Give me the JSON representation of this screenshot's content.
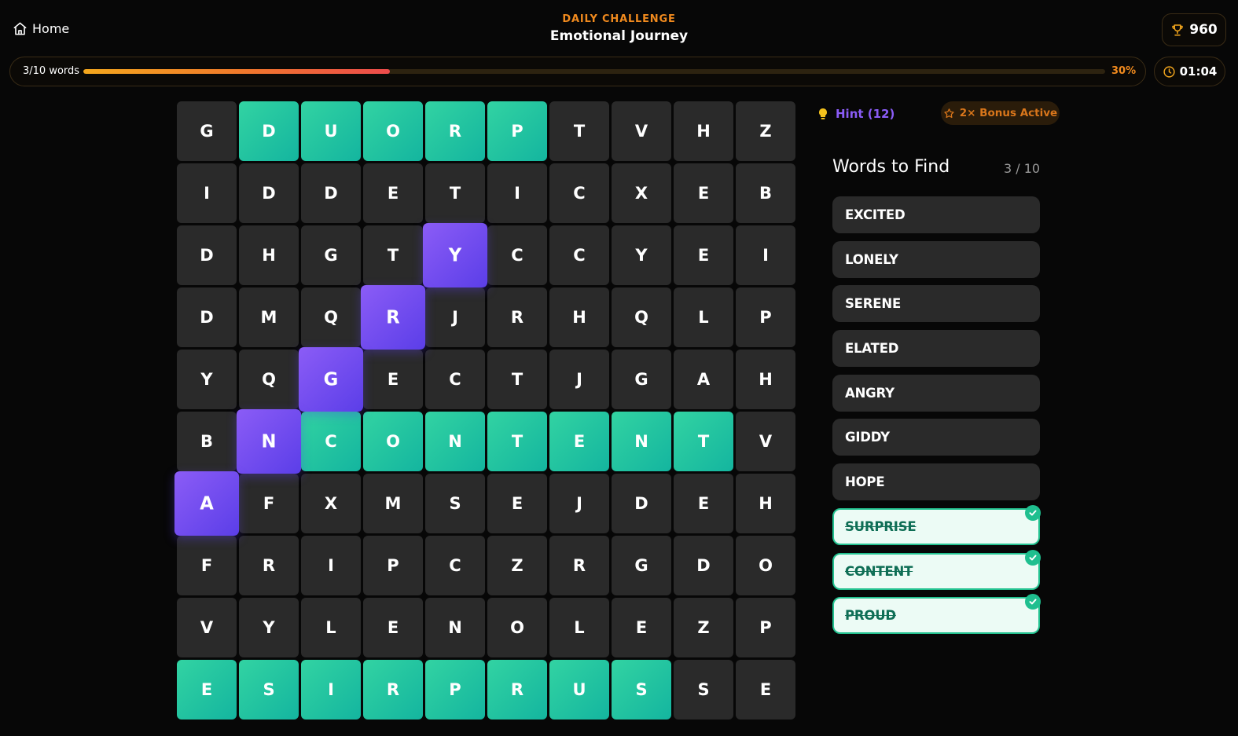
{
  "nav": {
    "home_label": "Home"
  },
  "header": {
    "eyebrow": "DAILY CHALLENGE",
    "title": "Emotional Journey"
  },
  "score": {
    "value": "960"
  },
  "progress": {
    "label": "3/10 words",
    "percent_label": "30%",
    "fraction": 0.3
  },
  "timer": {
    "value": "01:04"
  },
  "actions": {
    "hint_label": "Hint (12)",
    "bonus_label": "2× Bonus Active"
  },
  "panel": {
    "title": "Words to Find",
    "count": "3 / 10"
  },
  "colors": {
    "accent_orange": "#f08a1e",
    "found_green": "#1fbf8f",
    "select_purple": "#6d4af0",
    "hint_purple": "#8a5cf6"
  },
  "words": [
    {
      "label": "EXCITED",
      "found": false
    },
    {
      "label": "LONELY",
      "found": false
    },
    {
      "label": "SERENE",
      "found": false
    },
    {
      "label": "ELATED",
      "found": false
    },
    {
      "label": "ANGRY",
      "found": false
    },
    {
      "label": "GIDDY",
      "found": false
    },
    {
      "label": "HOPE",
      "found": false
    },
    {
      "label": "SURPRISE",
      "found": true
    },
    {
      "label": "CONTENT",
      "found": true
    },
    {
      "label": "PROUD",
      "found": true
    }
  ],
  "grid": {
    "rows": [
      [
        "G",
        "D",
        "U",
        "O",
        "R",
        "P",
        "T",
        "V",
        "H",
        "Z"
      ],
      [
        "I",
        "D",
        "D",
        "E",
        "T",
        "I",
        "C",
        "X",
        "E",
        "B"
      ],
      [
        "D",
        "H",
        "G",
        "T",
        "Y",
        "C",
        "C",
        "Y",
        "E",
        "I"
      ],
      [
        "D",
        "M",
        "Q",
        "R",
        "J",
        "R",
        "H",
        "Q",
        "L",
        "P"
      ],
      [
        "Y",
        "Q",
        "G",
        "E",
        "C",
        "T",
        "J",
        "G",
        "A",
        "H"
      ],
      [
        "B",
        "N",
        "C",
        "O",
        "N",
        "T",
        "E",
        "N",
        "T",
        "V"
      ],
      [
        "A",
        "F",
        "X",
        "M",
        "S",
        "E",
        "J",
        "D",
        "E",
        "H"
      ],
      [
        "F",
        "R",
        "I",
        "P",
        "C",
        "Z",
        "R",
        "G",
        "D",
        "O"
      ],
      [
        "V",
        "Y",
        "L",
        "E",
        "N",
        "O",
        "L",
        "E",
        "Z",
        "P"
      ],
      [
        "E",
        "S",
        "I",
        "R",
        "P",
        "R",
        "U",
        "S",
        "S",
        "E"
      ]
    ],
    "found_cells": [
      [
        0,
        1
      ],
      [
        0,
        2
      ],
      [
        0,
        3
      ],
      [
        0,
        4
      ],
      [
        0,
        5
      ],
      [
        5,
        2
      ],
      [
        5,
        3
      ],
      [
        5,
        4
      ],
      [
        5,
        5
      ],
      [
        5,
        6
      ],
      [
        5,
        7
      ],
      [
        5,
        8
      ],
      [
        9,
        0
      ],
      [
        9,
        1
      ],
      [
        9,
        2
      ],
      [
        9,
        3
      ],
      [
        9,
        4
      ],
      [
        9,
        5
      ],
      [
        9,
        6
      ],
      [
        9,
        7
      ]
    ],
    "selected_cells": [
      [
        2,
        4
      ],
      [
        3,
        3
      ],
      [
        4,
        2
      ],
      [
        5,
        1
      ],
      [
        6,
        0
      ]
    ]
  }
}
